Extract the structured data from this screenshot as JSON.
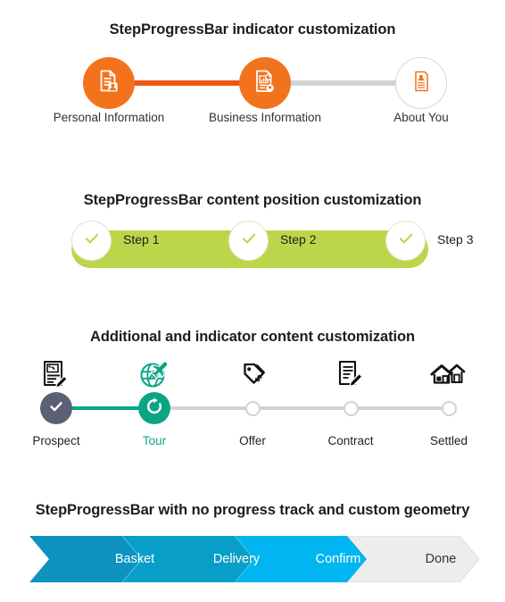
{
  "sections": [
    {
      "id": "indicator-customization",
      "title": "StepProgressBar indicator customization",
      "accent": "#f3721c",
      "track_inactive": "#d2d2d2",
      "steps": [
        {
          "label": "Personal Information",
          "state": "done",
          "icon": "document-person-icon"
        },
        {
          "label": "Business Information",
          "state": "done",
          "icon": "document-chart-gear-icon"
        },
        {
          "label": "About You",
          "state": "pending",
          "icon": "resume-profile-icon"
        }
      ]
    },
    {
      "id": "content-position-customization",
      "title": "StepProgressBar content position customization",
      "accent": "#bcd64b",
      "steps": [
        {
          "label": "Step 1",
          "state": "done",
          "icon": "check-icon"
        },
        {
          "label": "Step 2",
          "state": "done",
          "icon": "check-icon"
        },
        {
          "label": "Step 3",
          "state": "done",
          "icon": "check-icon"
        }
      ]
    },
    {
      "id": "additional-and-indicator-content-customization",
      "title": "Additional and indicator content customization",
      "accent": "#0ca583",
      "complete_color": "#5c5f75",
      "track_inactive": "#d2d2d2",
      "steps": [
        {
          "label": "Prospect",
          "state": "complete",
          "top_icon": "document-handshake-pen-icon",
          "indicator": "check-icon"
        },
        {
          "label": "Tour",
          "state": "active",
          "top_icon": "globe-airplane-icon",
          "indicator": "refresh-icon"
        },
        {
          "label": "Offer",
          "state": "pending",
          "top_icon": "price-tags-dollar-icon",
          "indicator": "empty-circle-icon"
        },
        {
          "label": "Contract",
          "state": "pending",
          "top_icon": "document-pencil-icon",
          "indicator": "empty-circle-icon"
        },
        {
          "label": "Settled",
          "state": "pending",
          "top_icon": "two-houses-icon",
          "indicator": "empty-circle-icon"
        }
      ]
    },
    {
      "id": "no-progress-track-custom-geometry",
      "title": "StepProgressBar with no progress track and custom geometry",
      "steps": [
        {
          "label": "Basket",
          "state": "done",
          "color": "#0d93bd"
        },
        {
          "label": "Delivery",
          "state": "done",
          "color": "#089ec8"
        },
        {
          "label": "Confirm",
          "state": "active",
          "color": "#00b5f0"
        },
        {
          "label": "Done",
          "state": "pending",
          "color": "#ededed"
        }
      ]
    }
  ]
}
